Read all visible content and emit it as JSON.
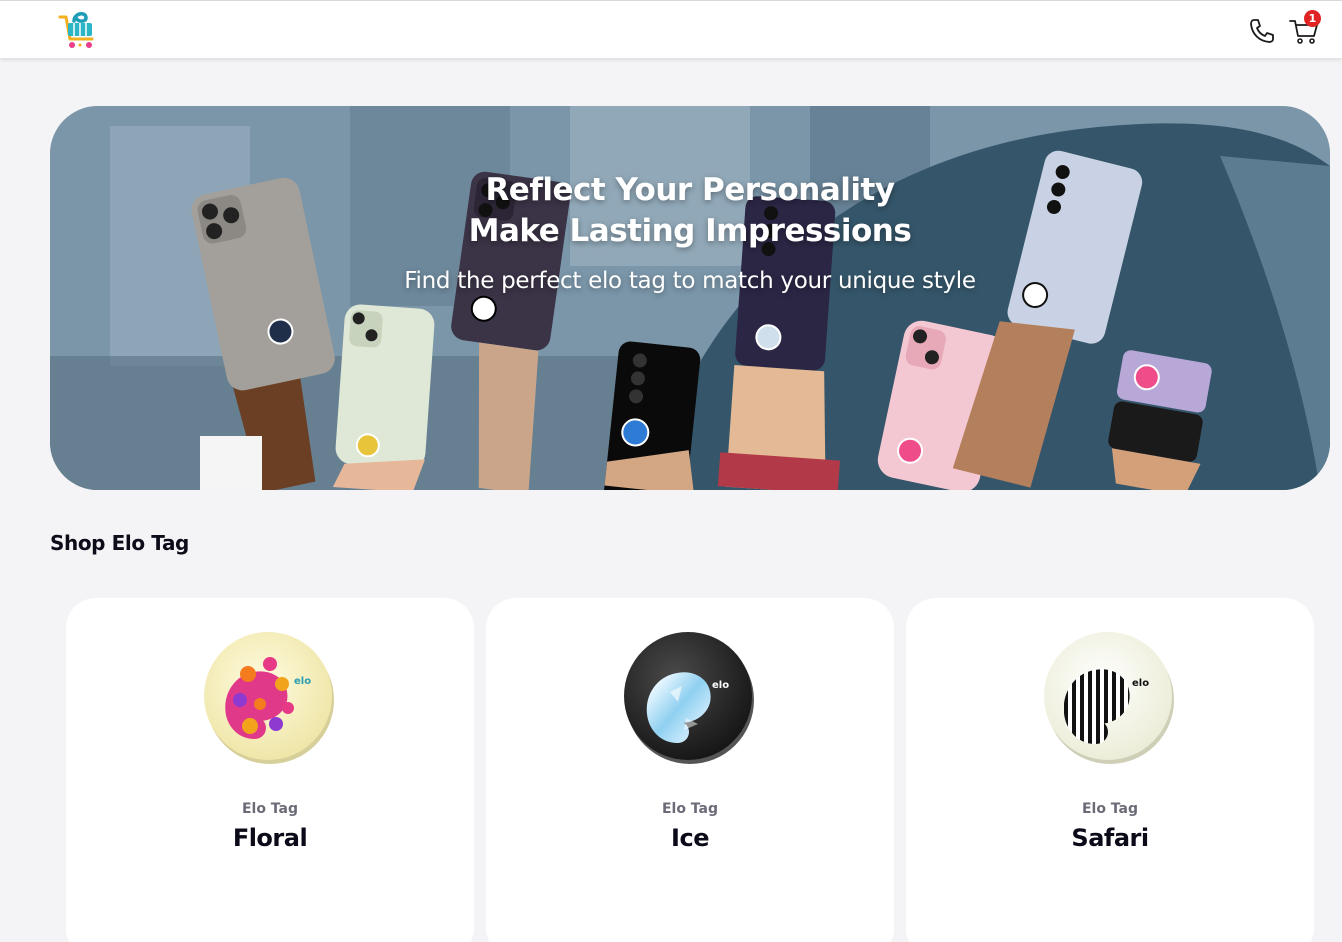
{
  "header": {
    "logo": "elo-cart-logo",
    "phone_icon": "phone-icon",
    "cart_icon": "cart-icon",
    "cart_count": "1"
  },
  "hero": {
    "title_line1": "Reflect Your Personality",
    "title_line2": "Make Lasting Impressions",
    "subtitle": "Find the perfect elo tag to match your unique style"
  },
  "section": {
    "title": "Shop Elo Tag"
  },
  "products": [
    {
      "kicker": "Elo Tag",
      "name": "Floral",
      "icon": "floral-elo-tag-image"
    },
    {
      "kicker": "Elo Tag",
      "name": "Ice",
      "icon": "ice-elo-tag-image"
    },
    {
      "kicker": "Elo Tag",
      "name": "Safari",
      "icon": "safari-elo-tag-image"
    }
  ],
  "colors": {
    "page_bg": "#f4f4f6",
    "badge": "#e02424",
    "hero_dark": "#35566a"
  }
}
